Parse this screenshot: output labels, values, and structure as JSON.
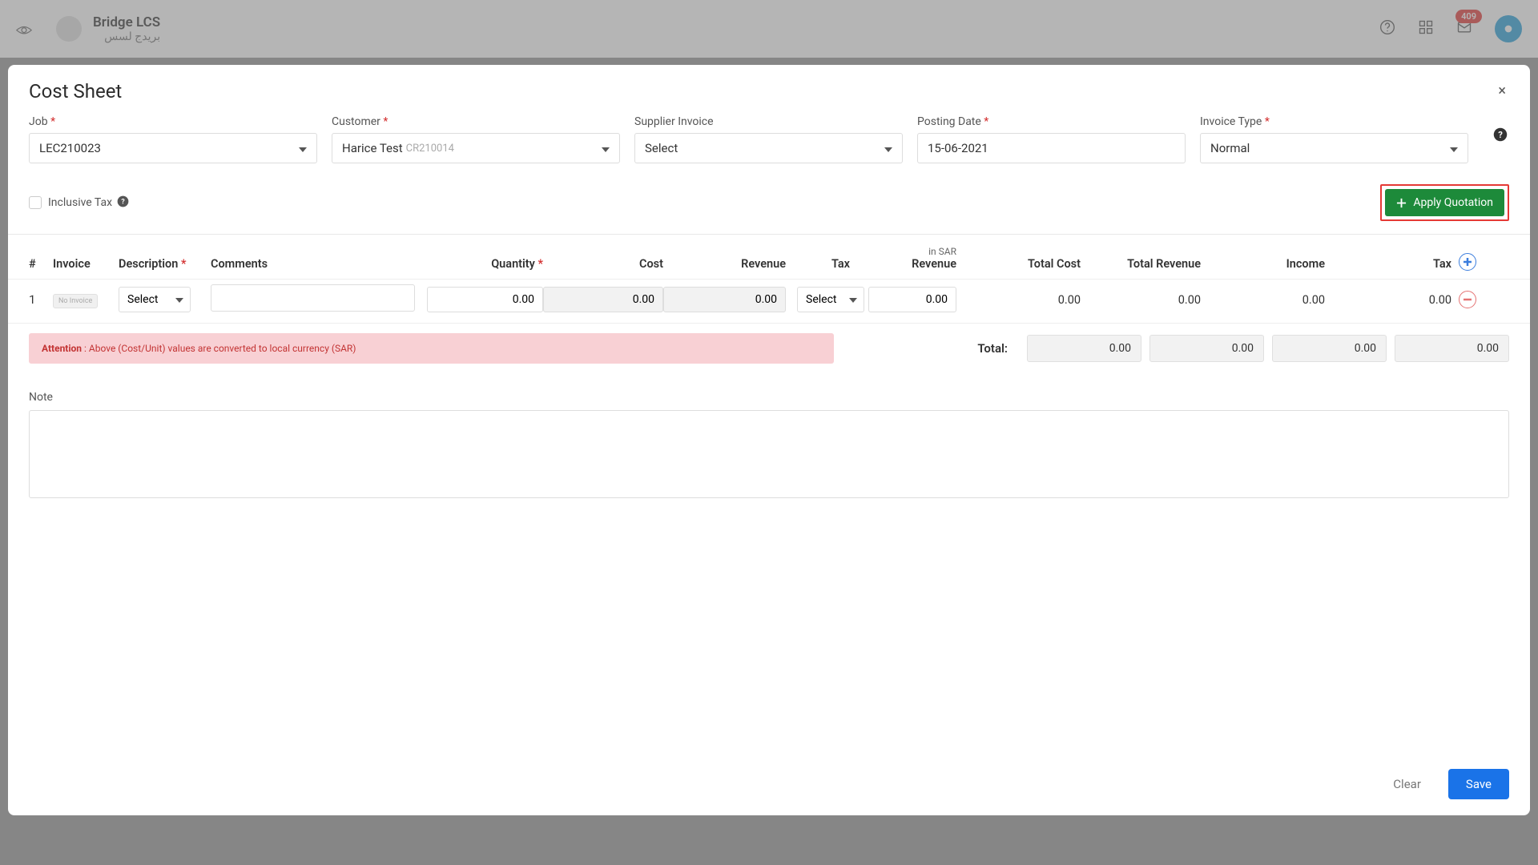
{
  "topbar": {
    "brand_title": "Bridge LCS",
    "brand_sub": "بريدج لسس",
    "badge_count": "409"
  },
  "modal": {
    "title": "Cost Sheet"
  },
  "fields": {
    "job_label": "Job",
    "job_value": "LEC210023",
    "customer_label": "Customer",
    "customer_value": "Harice Test",
    "customer_code": "CR210014",
    "supplier_label": "Supplier Invoice",
    "supplier_value": "Select",
    "posting_label": "Posting Date",
    "posting_value": "15-06-2021",
    "invoice_type_label": "Invoice Type",
    "invoice_type_value": "Normal"
  },
  "tax_row": {
    "inclusive_label": "Inclusive Tax",
    "apply_btn": "Apply Quotation"
  },
  "grid": {
    "h_num": "#",
    "h_invoice": "Invoice",
    "h_desc": "Description",
    "h_comments": "Comments",
    "h_qty": "Quantity",
    "h_cost": "Cost",
    "h_revenue": "Revenue",
    "h_tax": "Tax",
    "h_sar_sup": "in SAR",
    "h_sar": "Revenue",
    "h_totalcost": "Total Cost",
    "h_totalrev": "Total Revenue",
    "h_income": "Income",
    "h_taxval": "Tax",
    "row1": {
      "num": "1",
      "invoice_badge": "No Invoice",
      "desc_select": "Select",
      "qty": "0.00",
      "cost": "0.00",
      "revenue": "0.00",
      "tax_select": "Select",
      "sar": "0.00",
      "totalcost": "0.00",
      "totalrev": "0.00",
      "income": "0.00",
      "taxval": "0.00"
    }
  },
  "attention": {
    "bold": "Attention",
    "text": " : Above (Cost/Unit) values are converted to local currency (SAR)"
  },
  "totals": {
    "label": "Total:",
    "cost": "0.00",
    "revenue": "0.00",
    "income": "0.00",
    "tax": "0.00"
  },
  "note": {
    "label": "Note"
  },
  "footer": {
    "clear": "Clear",
    "save": "Save"
  }
}
